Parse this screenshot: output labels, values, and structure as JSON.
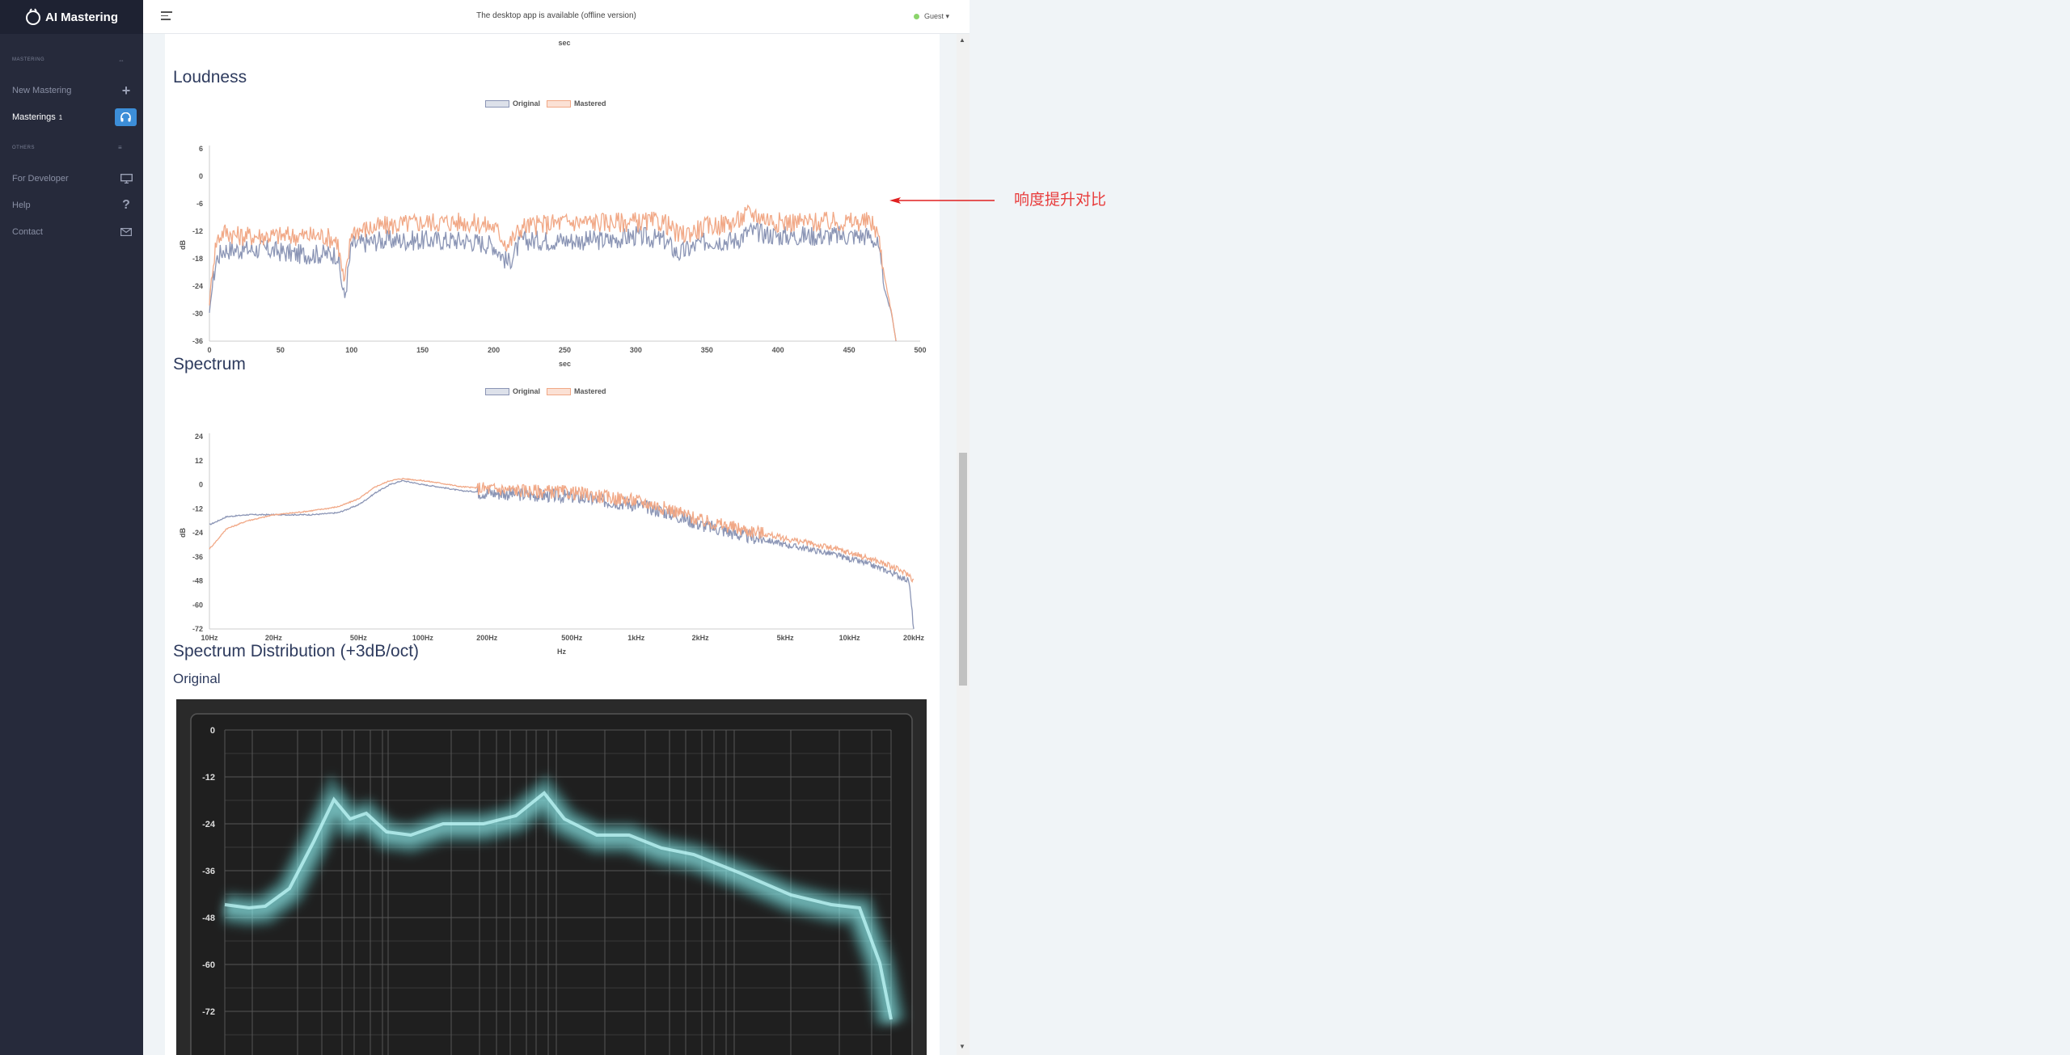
{
  "app": {
    "title": "AI Mastering"
  },
  "sidebar": {
    "section_mastering": "MASTERING",
    "section_others": "OTHERS",
    "items": [
      {
        "label": "New Mastering",
        "icon": "plus-icon"
      },
      {
        "label": "Masterings",
        "count": "1",
        "icon": "headphones-icon"
      },
      {
        "label": "For Developer",
        "icon": "monitor-icon"
      },
      {
        "label": "Help",
        "icon": "question-icon"
      },
      {
        "label": "Contact",
        "icon": "envelope-icon"
      }
    ]
  },
  "topbar": {
    "message": "The desktop app is available (offline version)",
    "user": "Guest"
  },
  "top_axis_unit": "sec",
  "loudness": {
    "title": "Loudness",
    "legend": [
      "Original",
      "Mastered"
    ],
    "chart_data": {
      "type": "line",
      "xlabel": "sec",
      "ylabel": "dB",
      "xlim": [
        0,
        500
      ],
      "ylim": [
        -36,
        6
      ],
      "xticks": [
        "0",
        "50",
        "100",
        "150",
        "200",
        "250",
        "300",
        "350",
        "400",
        "450",
        "500"
      ],
      "yticks": [
        "6",
        "0",
        "-6",
        "-12",
        "-18",
        "-24",
        "-30",
        "-36"
      ],
      "series": [
        {
          "name": "Original",
          "color": "#8b95b5",
          "x": [
            0,
            2,
            5,
            10,
            20,
            40,
            60,
            80,
            90,
            95,
            100,
            120,
            150,
            180,
            200,
            210,
            220,
            250,
            280,
            300,
            320,
            330,
            350,
            370,
            380,
            400,
            420,
            450,
            465,
            470,
            475,
            480,
            483
          ],
          "values": [
            -30,
            -24,
            -18,
            -16,
            -16,
            -16,
            -17,
            -17,
            -17,
            -27,
            -15,
            -14,
            -14,
            -14,
            -15,
            -19,
            -14,
            -14,
            -14,
            -13,
            -14,
            -17,
            -14,
            -14,
            -12,
            -13,
            -13,
            -13,
            -13,
            -15,
            -25,
            -30,
            -36
          ]
        },
        {
          "name": "Mastered",
          "color": "#f1a886",
          "x": [
            0,
            2,
            5,
            10,
            20,
            40,
            60,
            80,
            90,
            95,
            100,
            120,
            150,
            180,
            200,
            210,
            220,
            250,
            280,
            300,
            320,
            330,
            350,
            370,
            380,
            400,
            420,
            450,
            465,
            470,
            475,
            480,
            483
          ],
          "values": [
            -28,
            -20,
            -14,
            -12,
            -13,
            -13,
            -13,
            -13,
            -14,
            -24,
            -12,
            -11,
            -10,
            -10,
            -11,
            -15,
            -11,
            -10,
            -10,
            -10,
            -10,
            -13,
            -11,
            -10,
            -8,
            -10,
            -10,
            -10,
            -10,
            -12,
            -22,
            -30,
            -36
          ]
        }
      ]
    }
  },
  "annotation": {
    "text": "响度提升对比"
  },
  "spectrum": {
    "title": "Spectrum",
    "legend": [
      "Original",
      "Mastered"
    ],
    "chart_data": {
      "type": "line",
      "xlabel": "Hz",
      "ylabel": "dB",
      "xscale": "log",
      "xlim": [
        10,
        20000
      ],
      "ylim": [
        -72,
        24
      ],
      "xticks": [
        "10Hz",
        "20Hz",
        "50Hz",
        "100Hz",
        "200Hz",
        "500Hz",
        "1kHz",
        "2kHz",
        "5kHz",
        "10kHz",
        "20kHz"
      ],
      "yticks": [
        "24",
        "12",
        "0",
        "-12",
        "-24",
        "-36",
        "-48",
        "-60",
        "-72"
      ],
      "series": [
        {
          "name": "Original",
          "color": "#8b95b5",
          "x": [
            10,
            12,
            15,
            20,
            30,
            40,
            50,
            60,
            70,
            80,
            100,
            150,
            200,
            300,
            500,
            700,
            1000,
            1500,
            2000,
            3000,
            5000,
            7000,
            10000,
            15000,
            19000,
            20000
          ],
          "values": [
            -20,
            -16,
            -15,
            -15,
            -15,
            -14,
            -10,
            -4,
            0,
            2,
            0,
            -3,
            -4,
            -5,
            -6,
            -8,
            -10,
            -15,
            -20,
            -25,
            -30,
            -33,
            -37,
            -43,
            -48,
            -72
          ]
        },
        {
          "name": "Mastered",
          "color": "#f1a886",
          "x": [
            10,
            12,
            15,
            20,
            30,
            40,
            50,
            60,
            70,
            80,
            100,
            150,
            200,
            300,
            500,
            700,
            1000,
            1500,
            2000,
            3000,
            5000,
            7000,
            10000,
            15000,
            19000,
            20000
          ],
          "values": [
            -32,
            -22,
            -18,
            -15,
            -13,
            -11,
            -7,
            -1,
            2,
            3,
            2,
            -1,
            -2,
            -3,
            -4,
            -6,
            -8,
            -13,
            -18,
            -22,
            -27,
            -30,
            -34,
            -40,
            -45,
            -48
          ]
        }
      ]
    }
  },
  "distribution": {
    "title": "Spectrum Distribution (+3dB/oct)",
    "subtitle": "Original",
    "yticks": [
      "0",
      "-12",
      "-24",
      "-36",
      "-48",
      "-60",
      "-72"
    ]
  }
}
